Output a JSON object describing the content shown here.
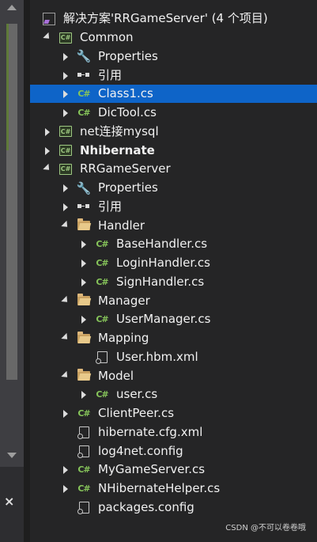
{
  "solution": {
    "label": "解决方案'RRGameServer' (4 个项目)"
  },
  "tree": [
    {
      "label": "Common",
      "icon": "csharp-project-icon",
      "expander": "down"
    },
    {
      "label": "Properties",
      "icon": "wrench-icon",
      "expander": "right"
    },
    {
      "label": "引用",
      "icon": "references-icon",
      "expander": "right"
    },
    {
      "label": "Class1.cs",
      "icon": "csharp-file-icon",
      "expander": "right",
      "selected": true
    },
    {
      "label": "DicTool.cs",
      "icon": "csharp-file-icon",
      "expander": "right"
    },
    {
      "label": "net连接mysql",
      "icon": "csharp-project-icon",
      "expander": "right"
    },
    {
      "label": "Nhibernate",
      "icon": "csharp-project-icon",
      "expander": "right",
      "bold": true
    },
    {
      "label": "RRGameServer",
      "icon": "csharp-project-icon",
      "expander": "down"
    },
    {
      "label": "Properties",
      "icon": "wrench-icon",
      "expander": "right"
    },
    {
      "label": "引用",
      "icon": "references-icon",
      "expander": "right"
    },
    {
      "label": "Handler",
      "icon": "folder-open-icon",
      "expander": "down"
    },
    {
      "label": "BaseHandler.cs",
      "icon": "csharp-file-icon",
      "expander": "right"
    },
    {
      "label": "LoginHandler.cs",
      "icon": "csharp-file-icon",
      "expander": "right"
    },
    {
      "label": "SignHandler.cs",
      "icon": "csharp-file-icon",
      "expander": "right"
    },
    {
      "label": "Manager",
      "icon": "folder-open-icon",
      "expander": "down"
    },
    {
      "label": "UserManager.cs",
      "icon": "csharp-file-icon",
      "expander": "right"
    },
    {
      "label": "Mapping",
      "icon": "folder-open-icon",
      "expander": "down"
    },
    {
      "label": "User.hbm.xml",
      "icon": "config-file-icon",
      "expander": "none"
    },
    {
      "label": "Model",
      "icon": "folder-open-icon",
      "expander": "down"
    },
    {
      "label": "user.cs",
      "icon": "csharp-file-icon",
      "expander": "right"
    },
    {
      "label": "ClientPeer.cs",
      "icon": "csharp-file-icon",
      "expander": "right"
    },
    {
      "label": "hibernate.cfg.xml",
      "icon": "config-file-icon",
      "expander": "none"
    },
    {
      "label": "log4net.config",
      "icon": "config-file-icon",
      "expander": "none"
    },
    {
      "label": "MyGameServer.cs",
      "icon": "csharp-file-icon",
      "expander": "right"
    },
    {
      "label": "NHibernateHelper.cs",
      "icon": "csharp-file-icon",
      "expander": "right"
    },
    {
      "label": "packages.config",
      "icon": "config-file-icon",
      "expander": "none"
    }
  ],
  "gutter": {
    "close_glyph": "×"
  },
  "watermark": "CSDN @不可以卷卷哦"
}
